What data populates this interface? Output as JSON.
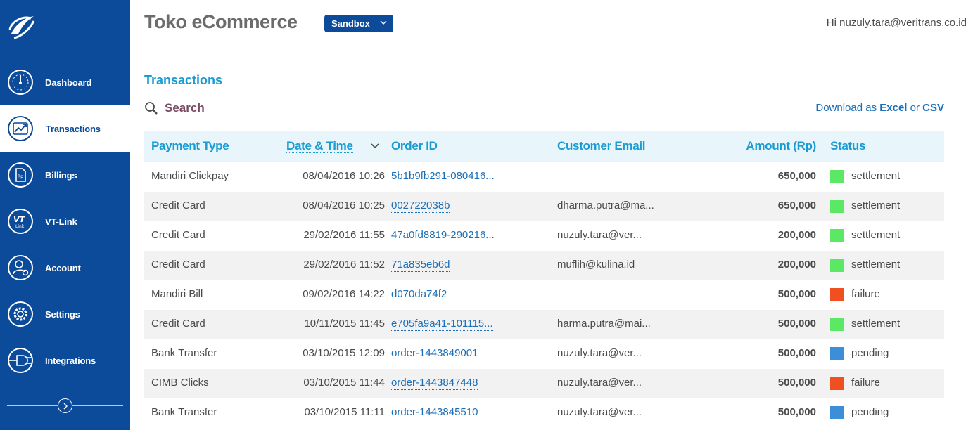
{
  "colors": {
    "brand": "#0c4a9a",
    "accent": "#1a9bd2",
    "link": "#1a6fb8",
    "settlement": "#5be865",
    "failure": "#f0501f",
    "pending": "#3d8ed8"
  },
  "sidebar": {
    "logo_icon": "veritrans-logo-icon",
    "items": [
      {
        "label": "Dashboard",
        "icon": "gauge-icon"
      },
      {
        "label": "Transactions",
        "icon": "trend-arrows-icon"
      },
      {
        "label": "Billings",
        "icon": "invoice-icon"
      },
      {
        "label": "VT-Link",
        "icon": "vt-link-icon"
      },
      {
        "label": "Account",
        "icon": "user-settings-icon"
      },
      {
        "label": "Settings",
        "icon": "gear-icon"
      },
      {
        "label": "Integrations",
        "icon": "plug-icon"
      }
    ],
    "collapse_icon": "chevron-right-icon"
  },
  "header": {
    "title": "Toko eCommerce",
    "environment": "Sandbox",
    "greeting": "Hi nuzuly.tara@veritrans.co.id"
  },
  "page": {
    "section_title": "Transactions",
    "search_label": "Search",
    "download": {
      "prefix": "Download as ",
      "excel": "Excel",
      "or": " or ",
      "csv": "CSV"
    }
  },
  "table": {
    "columns": {
      "payment_type": "Payment Type",
      "date_time": "Date & Time",
      "order_id": "Order ID",
      "customer_email": "Customer Email",
      "amount": "Amount (Rp)",
      "status": "Status"
    },
    "rows": [
      {
        "payment_type": "Mandiri Clickpay",
        "date_time": "08/04/2016 10:26",
        "order_id": "5b1b9fb291-080416...",
        "customer_email": "",
        "amount": "650,000",
        "status": "settlement"
      },
      {
        "payment_type": "Credit Card",
        "date_time": "08/04/2016 10:25",
        "order_id": "002722038b",
        "customer_email": "dharma.putra@ma...",
        "amount": "650,000",
        "status": "settlement"
      },
      {
        "payment_type": "Credit Card",
        "date_time": "29/02/2016 11:55",
        "order_id": "47a0fd8819-290216...",
        "customer_email": "nuzuly.tara@ver...",
        "amount": "200,000",
        "status": "settlement"
      },
      {
        "payment_type": "Credit Card",
        "date_time": "29/02/2016 11:52",
        "order_id": "71a835eb6d",
        "customer_email": "muflih@kulina.id",
        "amount": "200,000",
        "status": "settlement"
      },
      {
        "payment_type": "Mandiri Bill",
        "date_time": "09/02/2016 14:22",
        "order_id": "d070da74f2",
        "customer_email": "",
        "amount": "500,000",
        "status": "failure"
      },
      {
        "payment_type": "Credit Card",
        "date_time": "10/11/2015 11:45",
        "order_id": "e705fa9a41-101115...",
        "customer_email": "harma.putra@mai...",
        "amount": "500,000",
        "status": "settlement"
      },
      {
        "payment_type": "Bank Transfer",
        "date_time": "03/10/2015 12:09",
        "order_id": "order-1443849001",
        "customer_email": "nuzuly.tara@ver...",
        "amount": "500,000",
        "status": "pending"
      },
      {
        "payment_type": "CIMB Clicks",
        "date_time": "03/10/2015 11:44",
        "order_id": "order-1443847448",
        "customer_email": "nuzuly.tara@ver...",
        "amount": "500,000",
        "status": "failure"
      },
      {
        "payment_type": "Bank Transfer",
        "date_time": "03/10/2015 11:11",
        "order_id": "order-1443845510",
        "customer_email": "nuzuly.tara@ver...",
        "amount": "500,000",
        "status": "pending"
      }
    ]
  }
}
